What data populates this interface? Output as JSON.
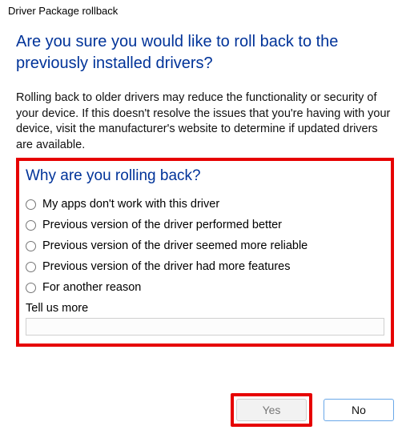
{
  "window": {
    "title": "Driver Package rollback"
  },
  "heading": "Are you sure you would like to roll back to the previously installed drivers?",
  "body": "Rolling back to older drivers may reduce the functionality or security of your device. If this doesn't resolve the issues that you're having with your device, visit the manufacturer's website to determine if updated drivers are available.",
  "section": {
    "title": "Why are you rolling back?",
    "options": [
      "My apps don't work with this driver",
      "Previous version of the driver performed better",
      "Previous version of the driver seemed more reliable",
      "Previous version of the driver had more features",
      "For another reason"
    ],
    "tell_more_label": "Tell us more",
    "tell_more_value": ""
  },
  "buttons": {
    "yes": "Yes",
    "no": "No"
  }
}
